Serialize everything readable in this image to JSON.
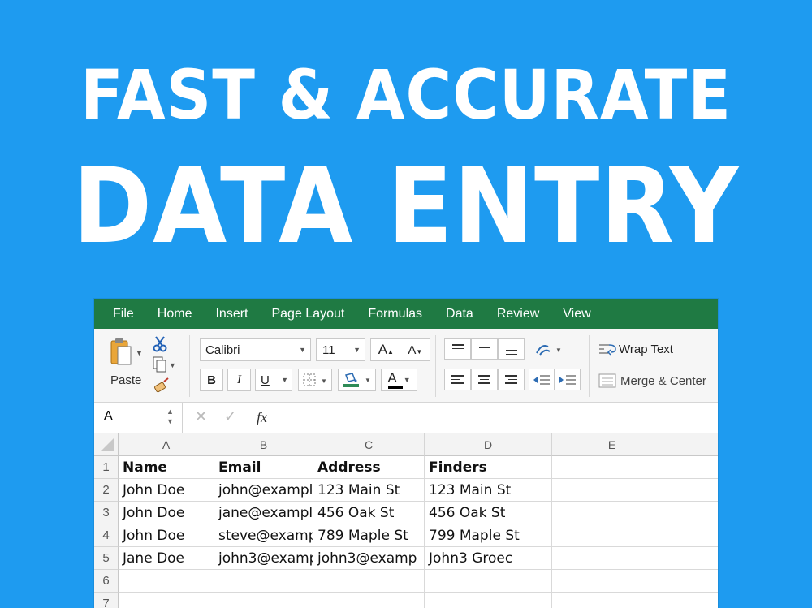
{
  "headline": {
    "line1": "FAST & ACCURATE",
    "line2": "DATA ENTRY"
  },
  "menu": [
    "File",
    "Home",
    "Insert",
    "Page Layout",
    "Formulas",
    "Data",
    "Review",
    "View"
  ],
  "ribbon": {
    "paste_label": "Paste",
    "font_name": "Calibri",
    "font_size": "11",
    "grow_font": "A",
    "shrink_font": "A",
    "bold": "B",
    "italic": "I",
    "underline": "U",
    "font_color_glyph": "A",
    "wrap_text": "Wrap Text",
    "merge_center": "Merge & Center"
  },
  "formula_bar": {
    "name_box": "A",
    "fx": "fx",
    "cancel": "✕",
    "confirm": "✓",
    "value": ""
  },
  "sheet": {
    "columns": [
      "A",
      "B",
      "C",
      "D",
      "E"
    ],
    "rows": [
      "1",
      "2",
      "3",
      "4",
      "5",
      "6",
      "7"
    ],
    "cells": [
      [
        "Name",
        "Email",
        "Address",
        "Finders",
        ""
      ],
      [
        "John Doe",
        "john@exampl.",
        "123 Main St",
        "123 Main St",
        ""
      ],
      [
        "John Doe",
        "jane@exampl.",
        "456 Oak St",
        "456 Oak St",
        ""
      ],
      [
        "John Doe",
        "steve@examp",
        "789 Maple St",
        "799 Maple St",
        ""
      ],
      [
        "Jane Doe",
        "john3@examp",
        "john3@examp",
        "John3 Groec",
        ""
      ],
      [
        "",
        "",
        "",
        "",
        ""
      ],
      [
        "",
        "",
        "",
        "",
        ""
      ]
    ]
  },
  "colors": {
    "background": "#1e9bf0",
    "menubar": "#1f7a43",
    "font_color_underline": "#000000",
    "fill_color_underline": "#2e8b57"
  }
}
